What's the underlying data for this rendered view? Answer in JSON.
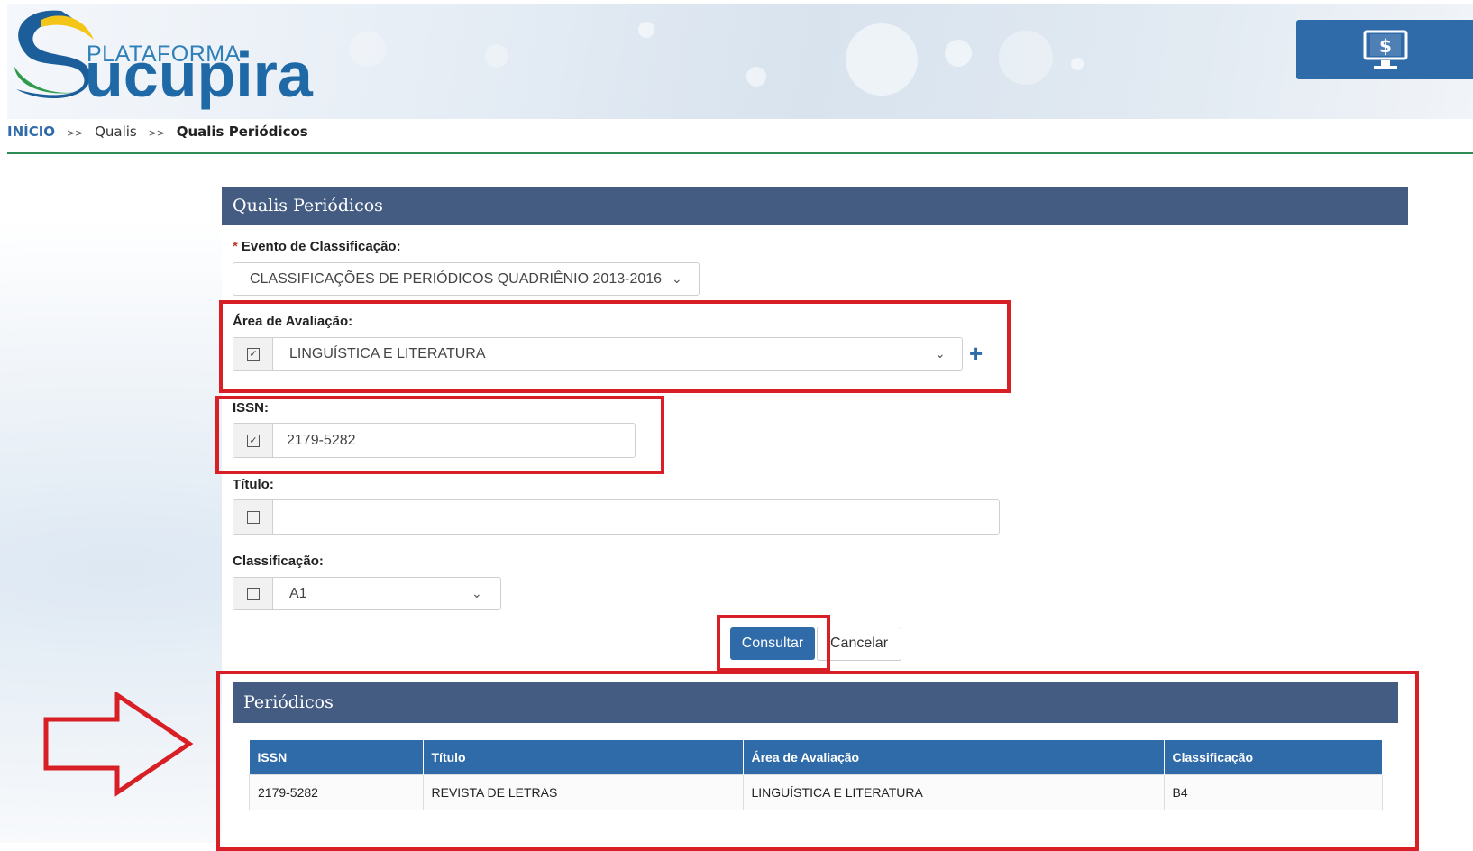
{
  "header": {
    "logo_small": "PLATAFORMA",
    "logo_big": "ucupira",
    "monitor_icon": "monitor-dollar-icon"
  },
  "breadcrumb": {
    "home": "INÍCIO",
    "sep": ">>",
    "item1": "Qualis",
    "current": "Qualis Periódicos"
  },
  "form": {
    "title": "Qualis Periódicos",
    "evento_label": "Evento de Classificação:",
    "evento_required": "*",
    "evento_value": "CLASSIFICAÇÕES DE PERIÓDICOS QUADRIÊNIO 2013-2016",
    "area_label": "Área de Avaliação:",
    "area_value": "LINGUÍSTICA E LITERATURA",
    "area_checked": true,
    "issn_label": "ISSN:",
    "issn_value": "2179-5282",
    "issn_checked": true,
    "titulo_label": "Título:",
    "titulo_value": "",
    "titulo_checked": false,
    "classificacao_label": "Classificação:",
    "classificacao_value": "A1",
    "classificacao_checked": false,
    "consultar": "Consultar",
    "cancelar": "Cancelar",
    "add_symbol": "+"
  },
  "results": {
    "title": "Periódicos",
    "columns": [
      "ISSN",
      "Título",
      "Área de Avaliação",
      "Classificação"
    ],
    "rows": [
      [
        "2179-5282",
        "REVISTA DE LETRAS",
        "LINGUÍSTICA E LITERATURA",
        "B4"
      ]
    ]
  },
  "colors": {
    "panel_header": "#445c82",
    "primary": "#2f6aa9",
    "annotation": "#d91f26"
  }
}
